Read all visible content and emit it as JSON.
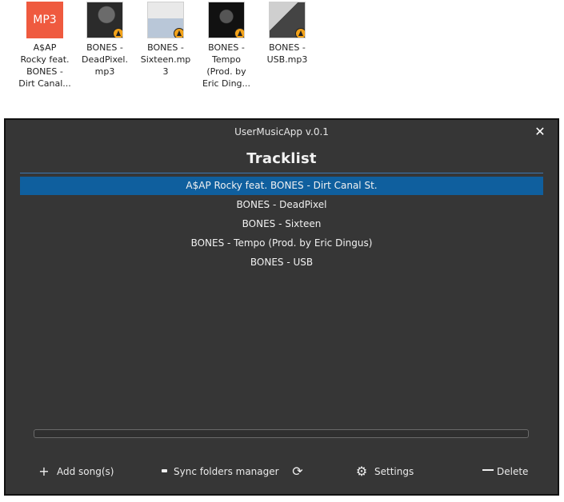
{
  "desktop": {
    "icons": [
      {
        "thumb_text": "MP3",
        "label": "A$AP\nRocky feat.\nBONES -\nDirt Canal..."
      },
      {
        "thumb_text": "",
        "label": "BONES -\nDeadPixel.\nmp3"
      },
      {
        "thumb_text": "",
        "label": "BONES -\nSixteen.mp\n3"
      },
      {
        "thumb_text": "",
        "label": "BONES -\nTempo\n(Prod. by\nEric Ding..."
      },
      {
        "thumb_text": "",
        "label": "BONES -\nUSB.mp3"
      }
    ]
  },
  "window": {
    "title": "UserMusicApp v.0.1",
    "close_symbol": "✕",
    "heading": "Tracklist",
    "tracks": [
      {
        "label": "A$AP Rocky feat. BONES - Dirt Canal St.",
        "selected": true
      },
      {
        "label": "BONES - DeadPixel",
        "selected": false
      },
      {
        "label": "BONES - Sixteen",
        "selected": false
      },
      {
        "label": "BONES - Tempo (Prod. by Eric Dingus)",
        "selected": false
      },
      {
        "label": "BONES - USB",
        "selected": false
      }
    ],
    "progress_fraction": 0,
    "toolbar": {
      "add_icon": "plus-icon",
      "add_symbol": "+",
      "add_label": "Add song(s)",
      "sync_icon": "folder-icon",
      "sync_label": "Sync folders manager",
      "refresh_icon": "refresh-icon",
      "refresh_symbol": "⟳",
      "settings_icon": "gear-icon",
      "settings_symbol": "⚙",
      "settings_label": "Settings",
      "delete_icon": "trash-icon",
      "delete_label": "Delete"
    }
  },
  "colors": {
    "window_bg": "#363636",
    "selected_row": "#0f5f9e",
    "accent_line": "#3c78b4",
    "mp3_icon": "#ef5a3f",
    "vlc_badge": "#f3a31a"
  }
}
